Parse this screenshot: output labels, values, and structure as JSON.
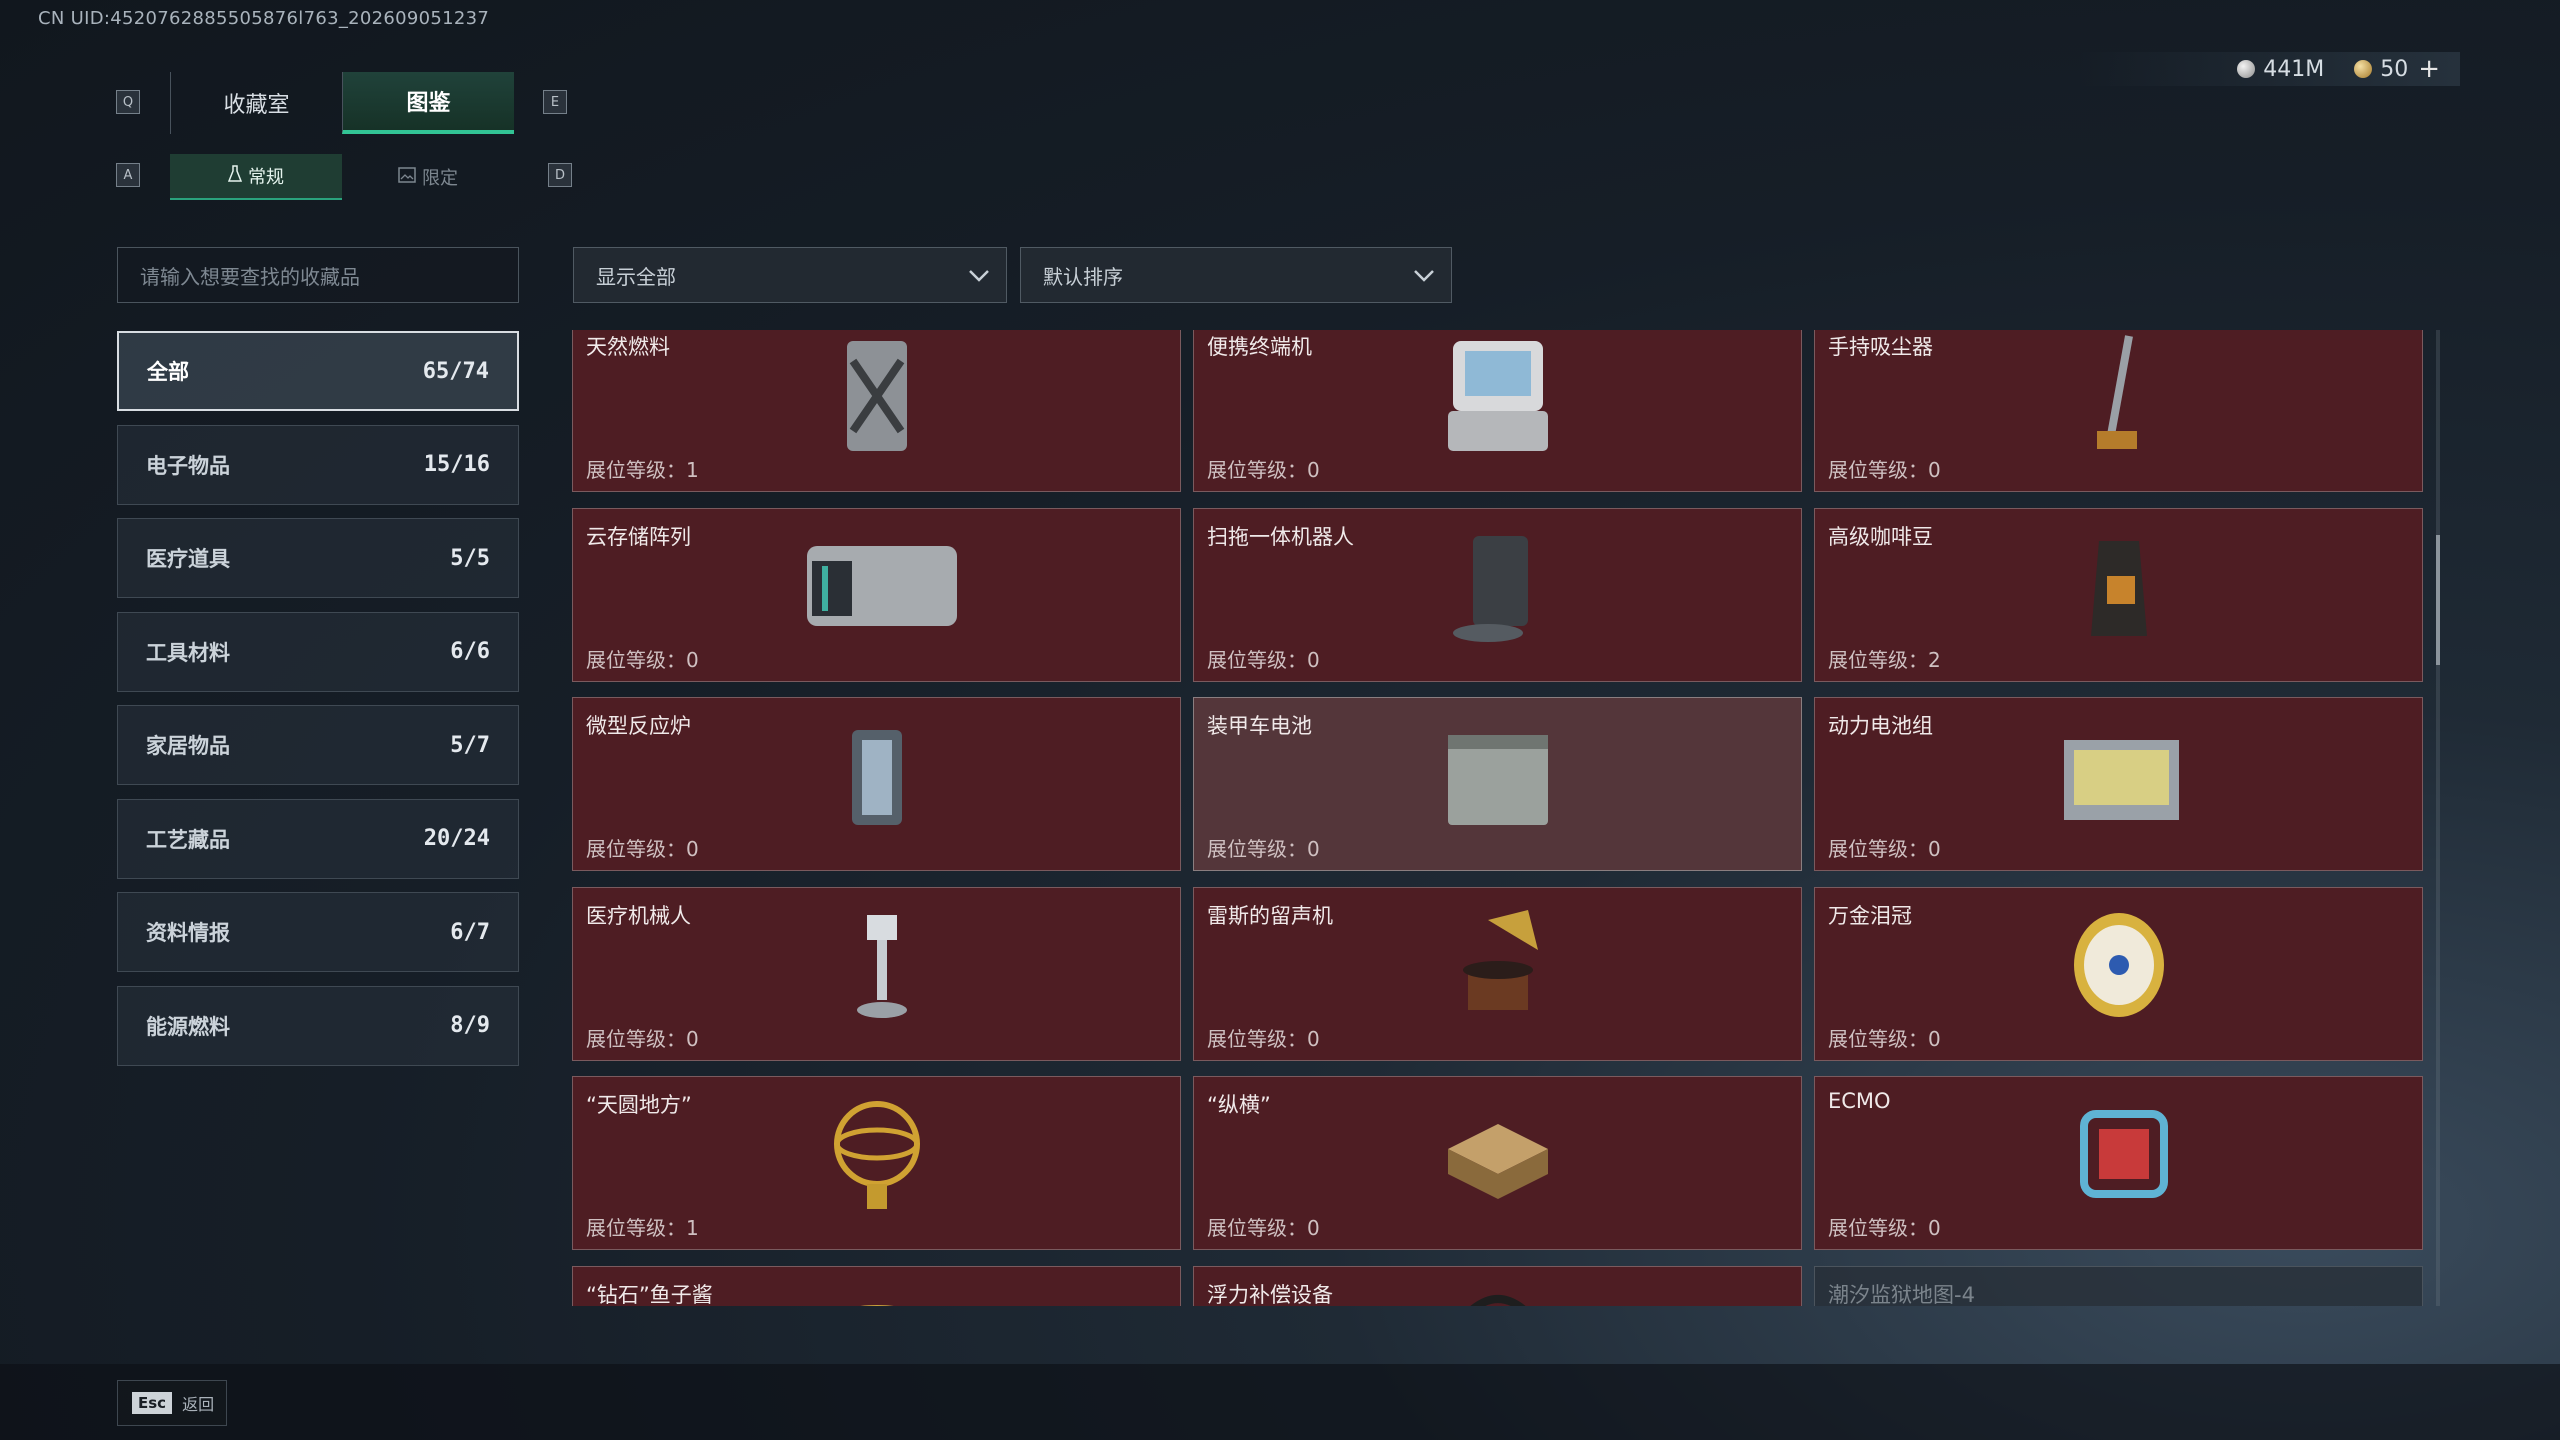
{
  "uid": "CN UID:4520762885505876l763_202609051237",
  "currency": {
    "silver": "441M",
    "gold": "50",
    "plus": "+"
  },
  "keys": {
    "prev_tab": "Q",
    "next_tab": "E",
    "prev_sub": "A",
    "next_sub": "D"
  },
  "tabs": [
    {
      "label": "收藏室"
    },
    {
      "label": "图鉴"
    }
  ],
  "subtabs": [
    {
      "label": "常规"
    },
    {
      "label": "限定"
    }
  ],
  "search": {
    "placeholder": "请输入想要查找的收藏品"
  },
  "filter": {
    "value": "显示全部"
  },
  "sort": {
    "value": "默认排序"
  },
  "categories": [
    {
      "label": "全部",
      "count": "65/74"
    },
    {
      "label": "电子物品",
      "count": "15/16"
    },
    {
      "label": "医疗道具",
      "count": "5/5"
    },
    {
      "label": "工具材料",
      "count": "6/6"
    },
    {
      "label": "家居物品",
      "count": "5/7"
    },
    {
      "label": "工艺藏品",
      "count": "20/24"
    },
    {
      "label": "资料情报",
      "count": "6/7"
    },
    {
      "label": "能源燃料",
      "count": "8/9"
    }
  ],
  "items": [
    {
      "name": "天然燃料",
      "level": "展位等级：1",
      "icon": "fuel-can-icon"
    },
    {
      "name": "便携终端机",
      "level": "展位等级：0",
      "icon": "terminal-icon"
    },
    {
      "name": "手持吸尘器",
      "level": "展位等级：0",
      "icon": "vacuum-icon"
    },
    {
      "name": "云存储阵列",
      "level": "展位等级：0",
      "icon": "server-icon"
    },
    {
      "name": "扫拖一体机器人",
      "level": "展位等级：0",
      "icon": "robot-vacuum-icon"
    },
    {
      "name": "高级咖啡豆",
      "level": "展位等级：2",
      "icon": "coffee-bag-icon"
    },
    {
      "name": "微型反应炉",
      "level": "展位等级：0",
      "icon": "reactor-icon"
    },
    {
      "name": "装甲车电池",
      "level": "展位等级：0",
      "icon": "battery-icon"
    },
    {
      "name": "动力电池组",
      "level": "展位等级：0",
      "icon": "battery-pack-icon"
    },
    {
      "name": "医疗机械人",
      "level": "展位等级：0",
      "icon": "medical-robot-icon"
    },
    {
      "name": "雷斯的留声机",
      "level": "展位等级：0",
      "icon": "gramophone-icon"
    },
    {
      "name": "万金泪冠",
      "level": "展位等级：0",
      "icon": "jeweled-egg-icon"
    },
    {
      "name": "“天圆地方”",
      "level": "展位等级：1",
      "icon": "armillary-sphere-icon"
    },
    {
      "name": "“纵横”",
      "level": "展位等级：0",
      "icon": "chessboard-icon"
    },
    {
      "name": "ECMO",
      "level": "展位等级：0",
      "icon": "ecmo-icon"
    },
    {
      "name": "“钻石”鱼子酱",
      "level": "",
      "icon": "caviar-tin-icon"
    },
    {
      "name": "浮力补偿设备",
      "level": "",
      "icon": "bcd-gear-icon"
    },
    {
      "name": "潮汐监狱地图-4",
      "level": "",
      "icon": "map-icon"
    }
  ],
  "footer": {
    "esc_key": "Esc",
    "esc_label": "返回"
  },
  "colors": {
    "accent": "#32c495",
    "card_bg": "#4e1d23",
    "card_highlight": "#54363a"
  }
}
